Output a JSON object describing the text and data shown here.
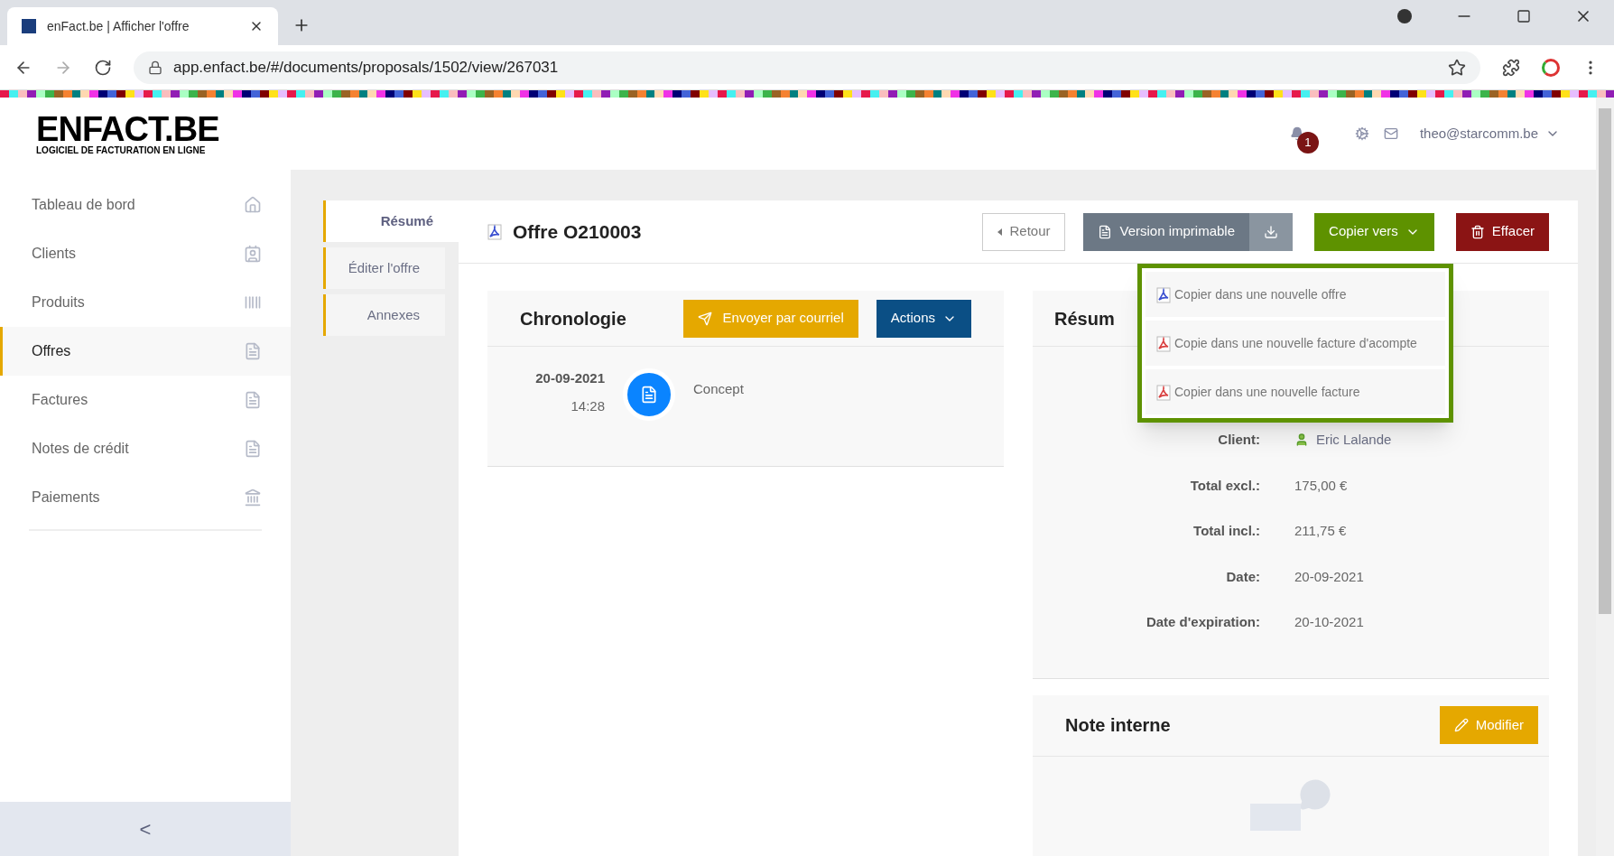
{
  "browser": {
    "tab_title": "enFact.be | Afficher l'offre",
    "url": "app.enfact.be/#/documents/proposals/1502/view/267031"
  },
  "header": {
    "logo": "ENFACT.BE",
    "tagline": "LOGICIEL DE FACTURATION EN LIGNE",
    "notification_count": "1",
    "user": "theo@starcomm.be"
  },
  "sidebar": {
    "items": [
      {
        "label": "Tableau de bord",
        "kind": "home",
        "selected": false
      },
      {
        "label": "Clients",
        "kind": "contacts",
        "selected": false
      },
      {
        "label": "Produits",
        "kind": "barcode",
        "selected": false
      },
      {
        "label": "Offres",
        "kind": "pdf",
        "selected": true
      },
      {
        "label": "Factures",
        "kind": "pdf",
        "selected": false
      },
      {
        "label": "Notes de crédit",
        "kind": "pdf",
        "selected": false
      },
      {
        "label": "Paiements",
        "kind": "bank",
        "selected": false
      }
    ],
    "collapse": "<"
  },
  "tabs": [
    {
      "label": "Résumé",
      "selected": true
    },
    {
      "label": "Éditer l'offre",
      "selected": false
    },
    {
      "label": "Annexes",
      "selected": false
    }
  ],
  "document": {
    "title": "Offre O210003",
    "buttons": {
      "back": "Retour",
      "print": "Version imprimable",
      "copy": "Copier vers",
      "delete": "Effacer"
    }
  },
  "copy_menu": [
    {
      "label": "Copier dans une nouvelle offre",
      "kind": "offer"
    },
    {
      "label": "Copie dans une nouvelle facture d'acompte",
      "kind": "invoice"
    },
    {
      "label": "Copier dans une nouvelle facture",
      "kind": "invoice"
    }
  ],
  "chronology": {
    "title": "Chronologie",
    "send_button": "Envoyer par courriel",
    "actions_button": "Actions",
    "entries": [
      {
        "date": "20-09-2021",
        "time": "14:28",
        "status": "Concept"
      }
    ]
  },
  "summary": {
    "title": "Résum",
    "fields": [
      {
        "label": "Client:",
        "value": "Eric Lalande",
        "kind": "client"
      },
      {
        "label": "Total excl.:",
        "value": "175,00 €",
        "kind": "text"
      },
      {
        "label": "Total incl.:",
        "value": "211,75 €",
        "kind": "text"
      },
      {
        "label": "Date:",
        "value": "20-09-2021",
        "kind": "text"
      },
      {
        "label": "Date d'expiration:",
        "value": "20-10-2021",
        "kind": "text"
      }
    ]
  },
  "note": {
    "title": "Note interne",
    "button": "Modifier"
  }
}
